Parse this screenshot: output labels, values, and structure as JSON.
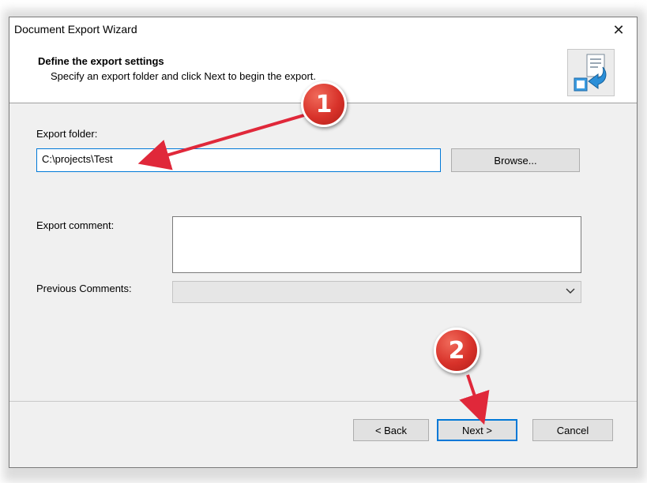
{
  "window": {
    "title": "Document Export Wizard",
    "close_glyph": "✕"
  },
  "header": {
    "title": "Define the export settings",
    "subtitle": "Specify an export folder and click Next to begin the export.",
    "icon": "export-wizard-icon"
  },
  "form": {
    "export_folder_label": "Export folder:",
    "export_folder_value": "C:\\projects\\Test",
    "browse_label": "Browse...",
    "export_comment_label": "Export comment:",
    "export_comment_value": "",
    "previous_comments_label": "Previous Comments:",
    "previous_comments_value": ""
  },
  "buttons": {
    "back": "< Back",
    "next": "Next >",
    "cancel": "Cancel"
  },
  "annotations": {
    "badge1": "1",
    "badge2": "2",
    "color": "#d8322a"
  },
  "colors": {
    "accent": "#0078d7",
    "window_bg": "#f0f0f0",
    "annotation_arrow": "#e0283a"
  }
}
